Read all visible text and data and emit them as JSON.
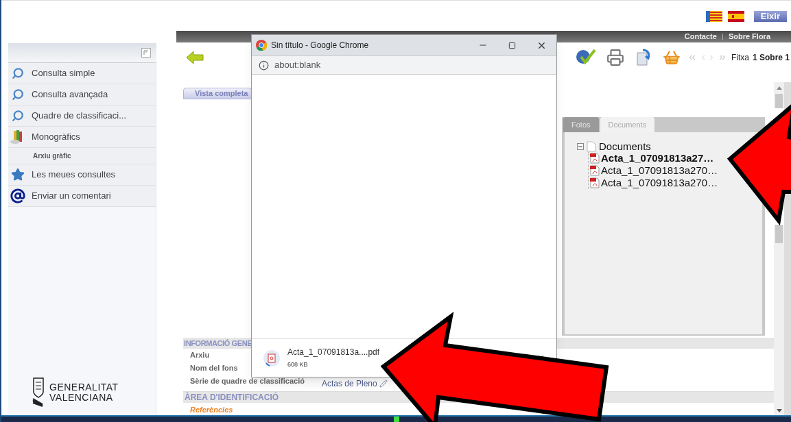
{
  "header": {
    "exit_button": "Eixir",
    "top_links": [
      "Contacte",
      "Sobre Flora"
    ]
  },
  "sidebar": {
    "items": [
      {
        "label": "Consulta simple",
        "kind": "search"
      },
      {
        "label": "Consulta avançada",
        "kind": "search"
      },
      {
        "label": "Quadre de classificaci...",
        "kind": "search"
      },
      {
        "label": "Monogràfics",
        "kind": "books"
      },
      {
        "label": "Arxiu gràfic",
        "kind": "sub"
      },
      {
        "label": "Les meues consultes",
        "kind": "star"
      },
      {
        "label": "Enviar un comentari",
        "kind": "at"
      }
    ],
    "logo": [
      "GENERALITAT",
      "VALENCIANA"
    ]
  },
  "toolbar": {
    "record_label": "Fitxa",
    "record_value": "1 Sobre 1"
  },
  "view_tab": "Vista completa",
  "media_tabs": [
    {
      "label": "Fotos",
      "selected": false
    },
    {
      "label": "Documents",
      "selected": true
    }
  ],
  "tree": {
    "label": "Documents",
    "expanded": true,
    "children": [
      {
        "label": "Acta_1_07091813a27…",
        "selected": true
      },
      {
        "label": "Acta_1_07091813a270…",
        "selected": false
      },
      {
        "label": "Acta_1_07091813a270…",
        "selected": false
      }
    ]
  },
  "info_section": {
    "title": "INFORMACIÓ GENE",
    "rows": [
      {
        "label": "Arxiu"
      },
      {
        "label": "Nom del fons"
      },
      {
        "label": "Sèrie de quadre de classificació",
        "value": "Actas de Pleno"
      }
    ]
  },
  "identification_section": {
    "title": "ÀREA D'IDENTIFICACIÓ",
    "subheading": "Referències"
  },
  "popup": {
    "title": "Sin título - Google Chrome",
    "url": "about:blank",
    "download": {
      "filename": "Acta_1_07091813a....pdf",
      "size": "608 KB"
    }
  }
}
